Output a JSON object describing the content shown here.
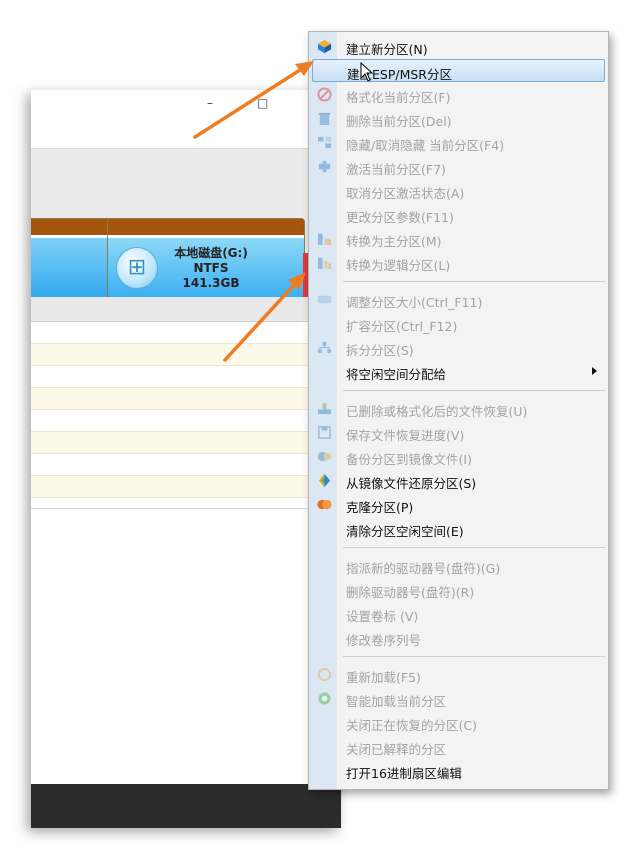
{
  "window": {
    "controls": {
      "minimize": "–",
      "maximize": "□"
    }
  },
  "disk": {
    "partition_g": {
      "name": "本地磁盘(G:)",
      "fs": "NTFS",
      "size": "141.3GB"
    }
  },
  "menu": {
    "items": [
      {
        "label": "建立新分区(N)",
        "enabled": true,
        "icon": "cube-icon"
      },
      {
        "label": "建立ESP/MSR分区",
        "enabled": true,
        "icon": "none"
      },
      {
        "label": "格式化当前分区(F)",
        "enabled": false,
        "icon": "no-entry-icon"
      },
      {
        "label": "删除当前分区(Del)",
        "enabled": false,
        "icon": "trash-icon"
      },
      {
        "label": "隐藏/取消隐藏 当前分区(F4)",
        "enabled": false,
        "icon": "hide-icon"
      },
      {
        "label": "激活当前分区(F7)",
        "enabled": false,
        "icon": "activate-icon"
      },
      {
        "label": "取消分区激活状态(A)",
        "enabled": false,
        "icon": "none"
      },
      {
        "label": "更改分区参数(F11)",
        "enabled": false,
        "icon": "none"
      },
      {
        "label": "转换为主分区(M)",
        "enabled": false,
        "icon": "convert-primary-icon"
      },
      {
        "label": "转换为逻辑分区(L)",
        "enabled": false,
        "icon": "convert-logical-icon"
      },
      {
        "label": "调整分区大小(Ctrl_F11)",
        "enabled": false,
        "icon": "resize-icon"
      },
      {
        "label": "扩容分区(Ctrl_F12)",
        "enabled": false,
        "icon": "none"
      },
      {
        "label": "拆分分区(S)",
        "enabled": false,
        "icon": "split-icon"
      },
      {
        "label": "将空闲空间分配给",
        "enabled": true,
        "icon": "none",
        "submenu": true
      },
      {
        "label": "已删除或格式化后的文件恢复(U)",
        "enabled": false,
        "icon": "recover-icon"
      },
      {
        "label": "保存文件恢复进度(V)",
        "enabled": false,
        "icon": "save-icon"
      },
      {
        "label": "备份分区到镜像文件(I)",
        "enabled": false,
        "icon": "backup-icon"
      },
      {
        "label": "从镜像文件还原分区(S)",
        "enabled": true,
        "icon": "restore-icon"
      },
      {
        "label": "克隆分区(P)",
        "enabled": true,
        "icon": "clone-icon"
      },
      {
        "label": "清除分区空闲空间(E)",
        "enabled": true,
        "icon": "none"
      },
      {
        "label": "指派新的驱动器号(盘符)(G)",
        "enabled": false,
        "icon": "none"
      },
      {
        "label": "删除驱动器号(盘符)(R)",
        "enabled": false,
        "icon": "none"
      },
      {
        "label": "设置卷标 (V)",
        "enabled": false,
        "icon": "none"
      },
      {
        "label": "修改卷序列号",
        "enabled": false,
        "icon": "none"
      },
      {
        "label": "重新加载(F5)",
        "enabled": false,
        "icon": "reload-icon"
      },
      {
        "label": "智能加载当前分区",
        "enabled": false,
        "icon": "smart-load-icon"
      },
      {
        "label": "关闭正在恢复的分区(C)",
        "enabled": false,
        "icon": "none"
      },
      {
        "label": "关闭已解释的分区",
        "enabled": false,
        "icon": "none"
      },
      {
        "label": "打开16进制扇区编辑",
        "enabled": true,
        "icon": "none"
      }
    ]
  },
  "colors": {
    "annotation_arrow": "#f07c21",
    "partition_header": "#a4560e",
    "partition_fill": "#3cb0f2",
    "menu_hover_border": "#7eaad8",
    "disabled_text": "#a3a3a3"
  }
}
